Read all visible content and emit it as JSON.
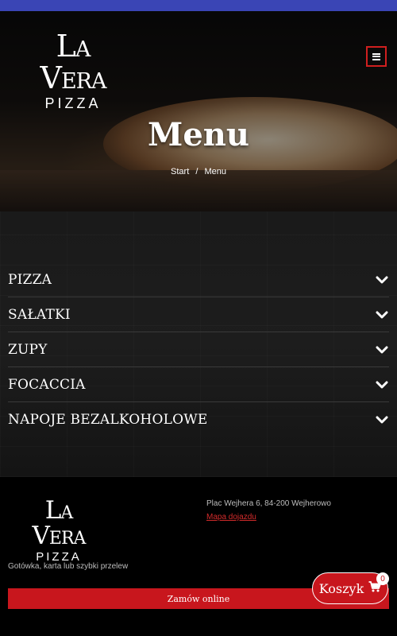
{
  "header": {
    "logo_line1": "La Vera",
    "logo_line2": "PIZZA",
    "menu_icon": "hamburger-icon"
  },
  "hero": {
    "title": "Menu",
    "breadcrumb": {
      "home": "Start",
      "separator": "/",
      "current": "Menu"
    }
  },
  "menu": {
    "categories": [
      {
        "label": "PIZZA"
      },
      {
        "label": "SAŁATKI"
      },
      {
        "label": "ZUPY"
      },
      {
        "label": "FOCACCIA"
      },
      {
        "label": "NAPOJE BEZALKOHOLOWE"
      }
    ],
    "expand_icon": "chevron-down-icon"
  },
  "footer": {
    "logo_line1": "La Vera",
    "logo_line2": "PIZZA",
    "address": "Plac Wejhera 6, 84-200 Wejherowo",
    "map_link": "Mapa dojazdu",
    "payment": "Gotówka, karta lub szybki przelew",
    "order_button": "Zamów online"
  },
  "cart": {
    "label": "Koszyk",
    "count": "0",
    "icon": "cart-icon"
  },
  "colors": {
    "top_bar": "#3a45b5",
    "accent": "#c8161d",
    "link": "#d42b2b"
  }
}
